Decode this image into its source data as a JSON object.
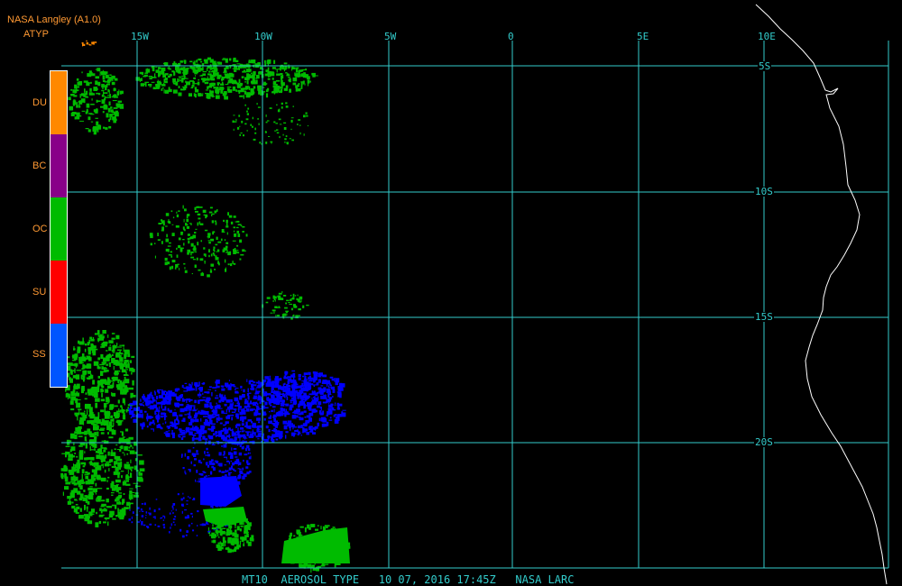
{
  "header": {
    "title": "NASA Langley (A1.0)",
    "product": "ATYP"
  },
  "legend": [
    {
      "label": "DU",
      "color": "#ff8800"
    },
    {
      "label": "BC",
      "color": "#880088"
    },
    {
      "label": "OC",
      "color": "#00bb00"
    },
    {
      "label": "SU",
      "color": "#ff0000"
    },
    {
      "label": "SS",
      "color": "#0055ff"
    }
  ],
  "lon_labels": [
    {
      "text": "15W",
      "lon": -15
    },
    {
      "text": "10W",
      "lon": -10
    },
    {
      "text": "5W",
      "lon": -5
    },
    {
      "text": "0",
      "lon": 0
    },
    {
      "text": "5E",
      "lon": 5
    },
    {
      "text": "10E",
      "lon": 10
    }
  ],
  "lat_labels": [
    {
      "text": "5S",
      "lat": -5
    },
    {
      "text": "10S",
      "lat": -10
    },
    {
      "text": "15S",
      "lat": -15
    },
    {
      "text": "20S",
      "lat": -20
    }
  ],
  "footer": "MT10  AEROSOL TYPE   10 07, 2016 17:45Z   NASA LARC",
  "colors": {
    "grid": "#33cccc",
    "coast": "#ffffff",
    "label": "#ff9933",
    "green_aerosol": "#00bb00",
    "blue_aerosol": "#0000ff"
  }
}
